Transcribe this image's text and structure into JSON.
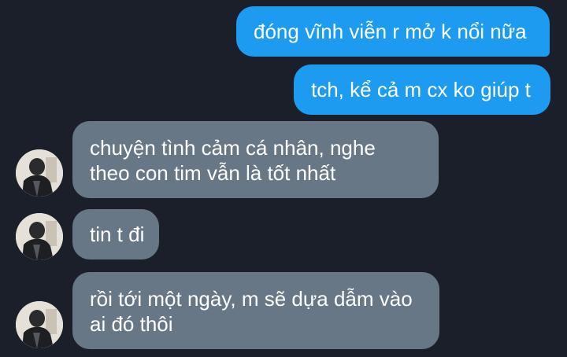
{
  "messages": [
    {
      "direction": "outgoing",
      "lines": [
        "đóng vĩnh viễn r mở k nổi nữa"
      ]
    },
    {
      "direction": "outgoing",
      "lines": [
        "tch, kể cả m cx ko giúp t"
      ]
    },
    {
      "direction": "incoming",
      "lines": [
        "chuyện tình cảm cá nhân, nghe",
        "theo con tim vẫn là tốt nhất"
      ]
    },
    {
      "direction": "incoming",
      "lines": [
        "tin t đi"
      ]
    },
    {
      "direction": "incoming",
      "lines": [
        "rồi tới một ngày, m sẽ dựa dẫm vào",
        "ai đó thôi"
      ]
    }
  ],
  "colors": {
    "background": "#1a1f29",
    "outgoing_bubble": "#1d9bf0",
    "incoming_bubble": "#677786",
    "text": "#ffffff"
  },
  "icons": {
    "avatar": "contact-avatar-photo"
  }
}
